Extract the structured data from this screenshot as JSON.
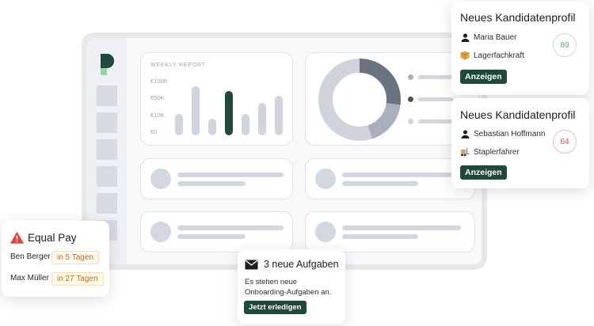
{
  "report": {
    "title": "WEEKLY REPORT",
    "y_ticks": [
      "€100K",
      "€50K",
      "€10K",
      "€0"
    ],
    "bars": [
      {
        "value": 0.38,
        "active": false
      },
      {
        "value": 0.88,
        "active": false
      },
      {
        "value": 0.3,
        "active": false
      },
      {
        "value": 0.8,
        "active": true
      },
      {
        "value": 0.38,
        "active": false
      },
      {
        "value": 0.58,
        "active": false
      },
      {
        "value": 0.72,
        "active": false
      }
    ]
  },
  "donut": {
    "segments": [
      {
        "fraction": 0.27,
        "color": "#6b7380"
      },
      {
        "fraction": 0.18,
        "color": "#a9b0bc"
      },
      {
        "fraction": 0.55,
        "color": "#cfd4dc"
      }
    ],
    "legend_colors": [
      "#a9b0bc",
      "#4b5260",
      "#cfd4dc"
    ]
  },
  "profile1": {
    "title": "Neues Kandidatenprofil",
    "name": "Maria Bauer",
    "role": "Lagerfachkraft",
    "score": "89",
    "score_color": "#5fb26c",
    "button": "Anzeigen",
    "role_icon": "package-icon"
  },
  "profile2": {
    "title": "Neues Kandidatenprofil",
    "name": "Sebastian Hoffmann",
    "role": "Staplerfahrer",
    "score": "64",
    "score_color": "#e2573b",
    "button": "Anzeigen",
    "role_icon": "forklift-icon"
  },
  "equal_pay": {
    "title": "Equal Pay",
    "rows": [
      {
        "name": "Ben Berger",
        "due": "in 5 Tagen"
      },
      {
        "name": "Max Müller",
        "due": "in 27 Tagen"
      }
    ],
    "warning_color": "#e2463b"
  },
  "tasks": {
    "title": "3 neue Aufgaben",
    "body": "Es stehen neue Onboarding-Aufgaben an.",
    "button": "Jetzt erledigen"
  }
}
